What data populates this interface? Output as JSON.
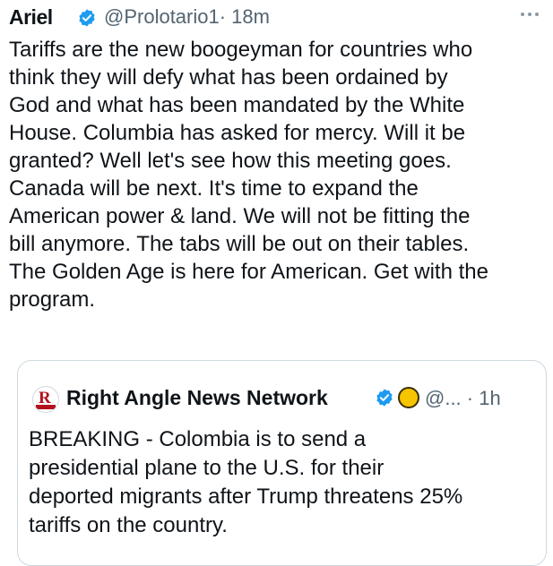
{
  "author": {
    "name": "Ariel",
    "handle": "@Prolotario1",
    "time": "· 18m"
  },
  "tweet_lines": [
    "Tariffs are the new boogeyman for countries who",
    "think they will defy what has been ordained by",
    "God and what has been mandated by the White",
    "House. Columbia has asked for mercy. Will it be",
    "granted? Well let's see how this meeting goes.",
    "Canada will be next. It's time to expand the",
    "American power & land. We will not be fitting the",
    "bill anymore. The tabs will be out on their tables.",
    "The Golden Age is here for American. Get with the",
    "program."
  ],
  "quote": {
    "name": "Right Angle News Network",
    "handle": "@... · 1h",
    "lines": [
      "BREAKING - Colombia is to send a",
      "presidential plane to the U.S. for their",
      "deported migrants after Trump threatens 25%",
      "tariffs on the country."
    ],
    "avatar_text": "R"
  },
  "icons": {
    "verified": "verified-badge-icon",
    "more": "more-options-icon",
    "affiliate": "affiliate-badge-icon"
  },
  "colors": {
    "verified_blue": "#1d9bf0",
    "secondary_text": "#536471",
    "affiliate_gold": "#f7c400"
  }
}
